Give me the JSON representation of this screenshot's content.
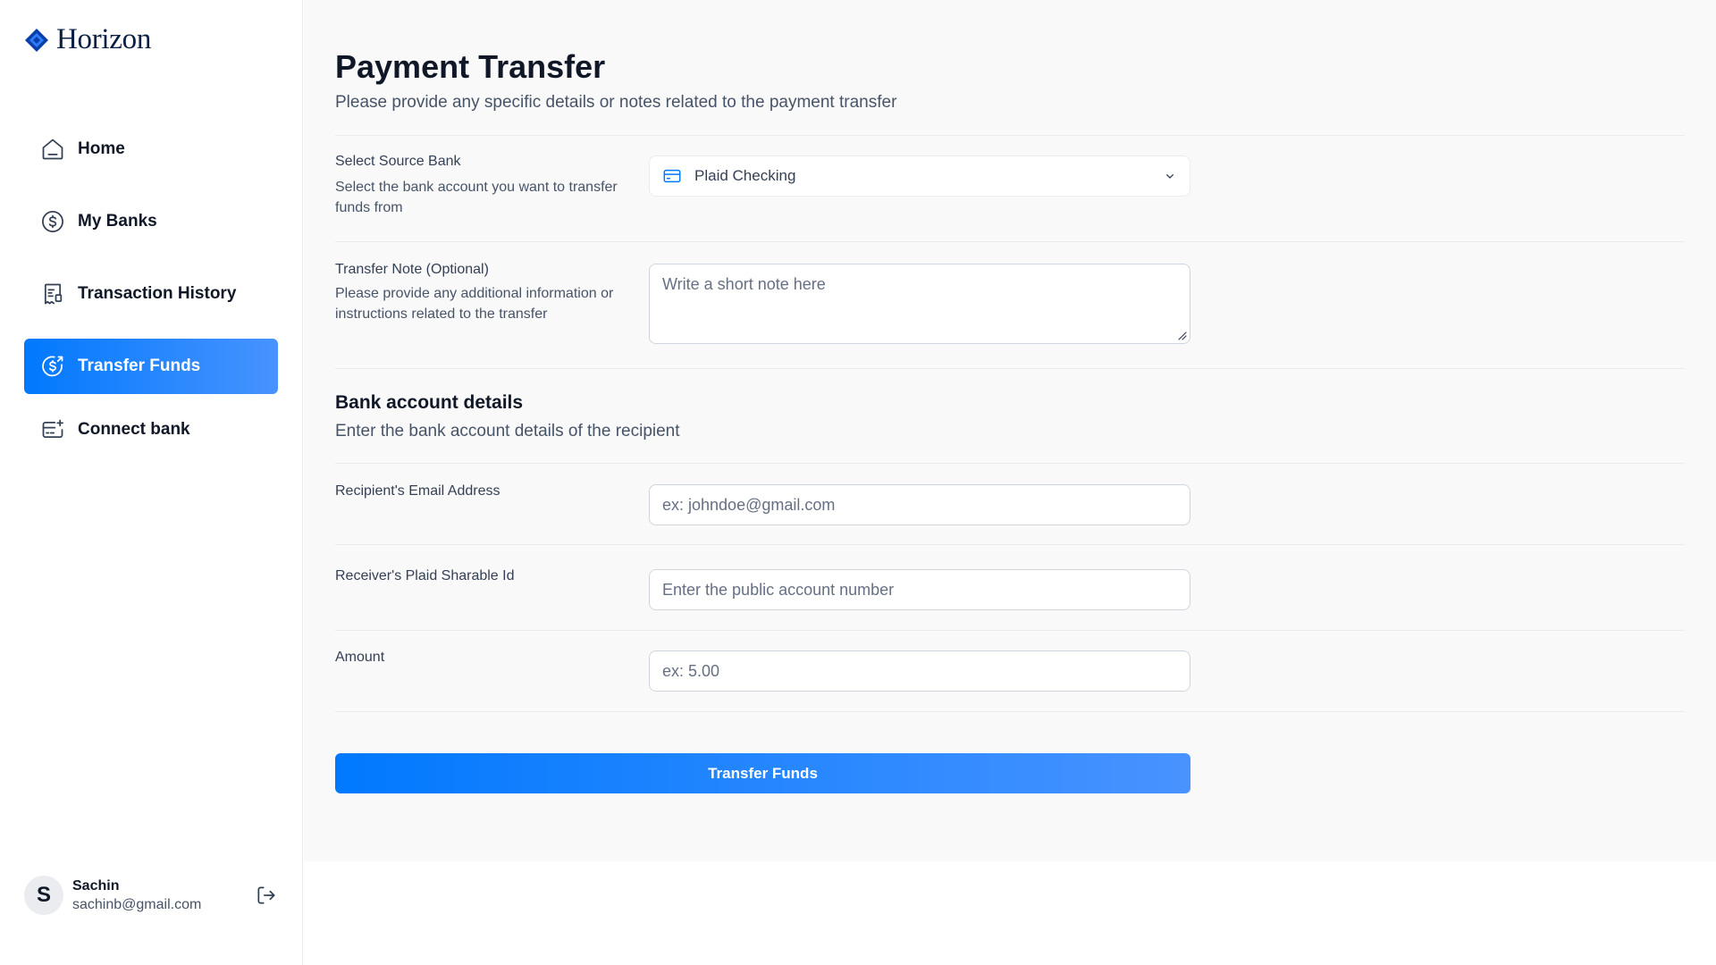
{
  "app": {
    "name": "Horizon"
  },
  "sidebar": {
    "items": [
      {
        "label": "Home",
        "icon": "home-icon",
        "active": false
      },
      {
        "label": "My Banks",
        "icon": "dollar-circle-icon",
        "active": false
      },
      {
        "label": "Transaction History",
        "icon": "receipt-icon",
        "active": false
      },
      {
        "label": "Transfer Funds",
        "icon": "money-send-icon",
        "active": true
      },
      {
        "label": "Connect bank",
        "icon": "card-add-icon",
        "active": false
      }
    ]
  },
  "user": {
    "initial": "S",
    "name": "Sachin",
    "email": "sachinb@gmail.com"
  },
  "page": {
    "title": "Payment Transfer",
    "subtitle": "Please provide any specific details or notes related to the payment transfer"
  },
  "form": {
    "source_bank": {
      "label": "Select Source Bank",
      "help": "Select the bank account you want to transfer funds from",
      "value": "Plaid Checking"
    },
    "note": {
      "label": "Transfer Note (Optional)",
      "help": "Please provide any additional information or instructions related to the transfer",
      "placeholder": "Write a short note here"
    },
    "bank_section": {
      "title": "Bank account details",
      "subtitle": "Enter the bank account details of the recipient"
    },
    "email": {
      "label": "Recipient's Email Address",
      "placeholder": "ex: johndoe@gmail.com"
    },
    "sharable_id": {
      "label": "Receiver's Plaid Sharable Id",
      "placeholder": "Enter the public account number"
    },
    "amount": {
      "label": "Amount",
      "placeholder": "ex: 5.00"
    },
    "submit_label": "Transfer Funds"
  },
  "colors": {
    "accent": "#0179FE",
    "accent_light": "#4893FF",
    "text_dark": "#101828",
    "text_muted": "#475467"
  }
}
